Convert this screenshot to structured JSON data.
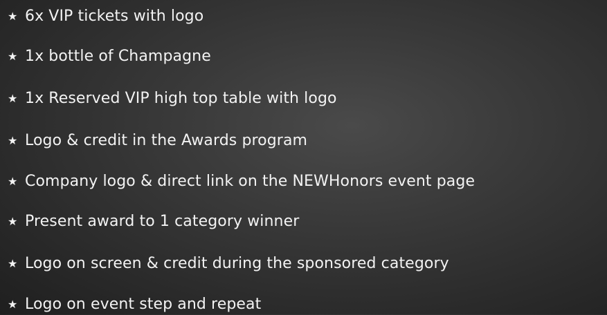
{
  "bullet_icon": "star-icon",
  "bullet_glyph": "★",
  "benefits": [
    "6x VIP tickets with logo",
    "1x bottle of Champagne",
    "1x Reserved VIP high top table with logo",
    "Logo & credit in the Awards program",
    "Company logo & direct link on the NEWHonors event page",
    "Present award to 1 category winner",
    "Logo on screen & credit during the sponsored category",
    "Logo on event step and repeat"
  ]
}
